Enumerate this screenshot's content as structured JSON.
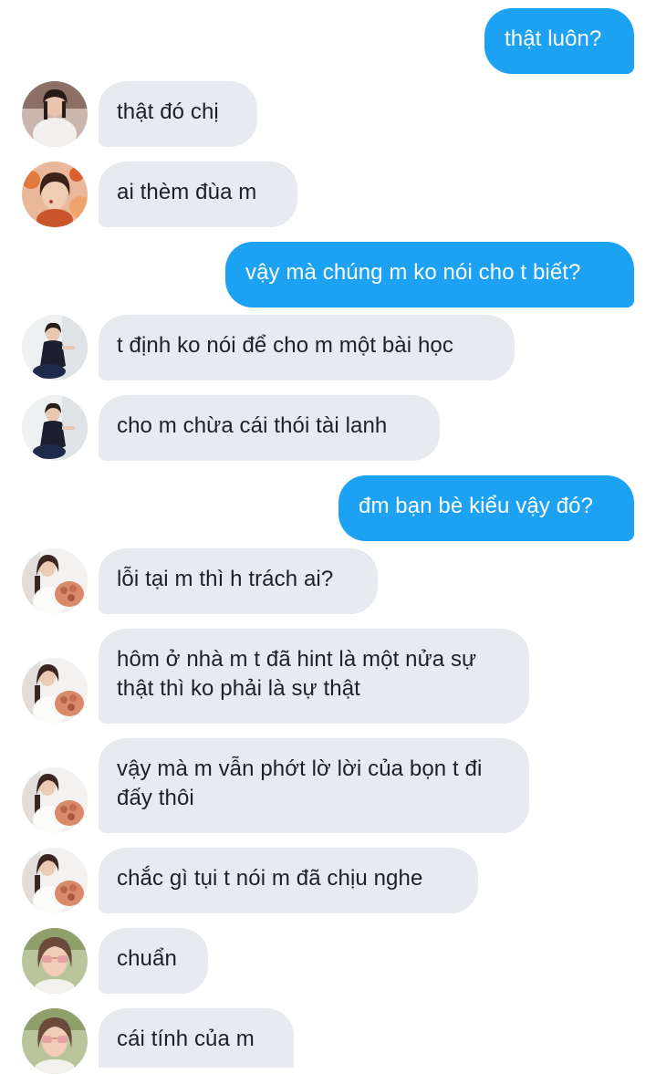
{
  "colors": {
    "outgoing_bubble": "#1da1f2",
    "incoming_bubble": "#e7ebef",
    "outgoing_text": "#ffffff",
    "incoming_text": "#1c2126"
  },
  "messages": [
    {
      "direction": "outgoing",
      "text": "thật luôn?"
    },
    {
      "direction": "incoming",
      "avatar": "avatar-woman-white-top-icon",
      "text": "thật đó chị"
    },
    {
      "direction": "incoming",
      "avatar": "avatar-woman-flowers-icon",
      "text": "ai thèm đùa m"
    },
    {
      "direction": "outgoing",
      "text": "vậy mà chúng m ko nói cho t biết?"
    },
    {
      "direction": "incoming",
      "avatar": "avatar-woman-black-dress-icon",
      "text": "t định ko nói để cho m một bài học"
    },
    {
      "direction": "incoming",
      "avatar": "avatar-woman-black-dress-icon",
      "text": "cho m chừa cái thói tài lanh"
    },
    {
      "direction": "outgoing",
      "text": "đm bạn bè kiểu vậy đó?"
    },
    {
      "direction": "incoming",
      "avatar": "avatar-woman-bouquet-icon",
      "text": "lỗi tại m thì h trách ai?"
    },
    {
      "direction": "incoming",
      "avatar": "avatar-woman-bouquet-icon",
      "text": "hôm ở nhà m t đã hint là một nửa sự\nthật thì ko phải là sự thật"
    },
    {
      "direction": "incoming",
      "avatar": "avatar-woman-bouquet-icon",
      "text": "vậy mà m vẫn phớt lờ lời của bọn t đi\nđấy thôi"
    },
    {
      "direction": "incoming",
      "avatar": "avatar-woman-bouquet-icon",
      "text": "chắc gì tụi t nói m đã chịu nghe"
    },
    {
      "direction": "incoming",
      "avatar": "avatar-woman-sunglasses-icon",
      "text": "chuẩn"
    },
    {
      "direction": "incoming",
      "avatar": "avatar-woman-sunglasses-icon",
      "text": "cái tính của m"
    }
  ]
}
